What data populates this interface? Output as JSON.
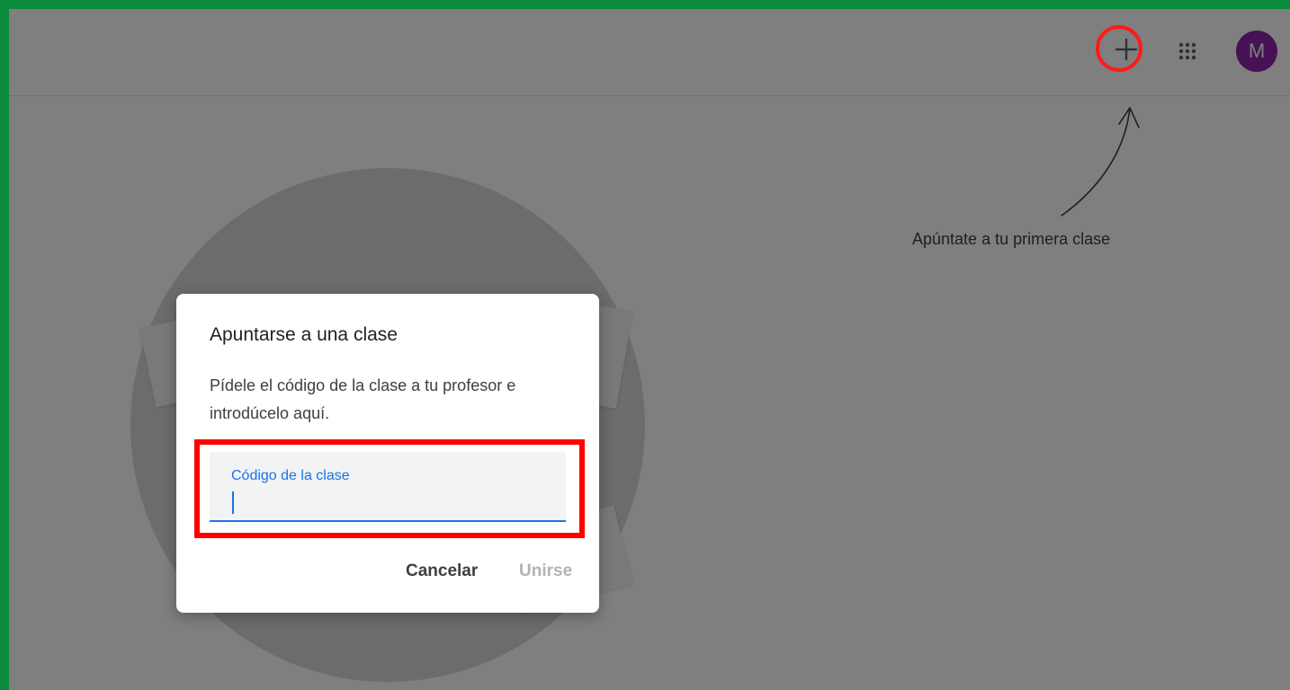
{
  "header": {
    "add_icon": "plus-icon",
    "apps_icon": "apps-grid-icon",
    "avatar_letter": "M",
    "avatar_color": "#8e24aa"
  },
  "hint": {
    "text": "Apúntate a tu primera clase"
  },
  "dialog": {
    "title": "Apuntarse a una clase",
    "description": "Pídele el código de la clase a tu profesor e introdúcelo aquí.",
    "field_label": "Código de la clase",
    "field_value": "",
    "cancel_label": "Cancelar",
    "join_label": "Unirse"
  },
  "colors": {
    "frame_border": "#0a8a3c",
    "highlight": "#ff0000",
    "accent": "#1a73e8",
    "disabled_text": "#b0b3b8"
  }
}
